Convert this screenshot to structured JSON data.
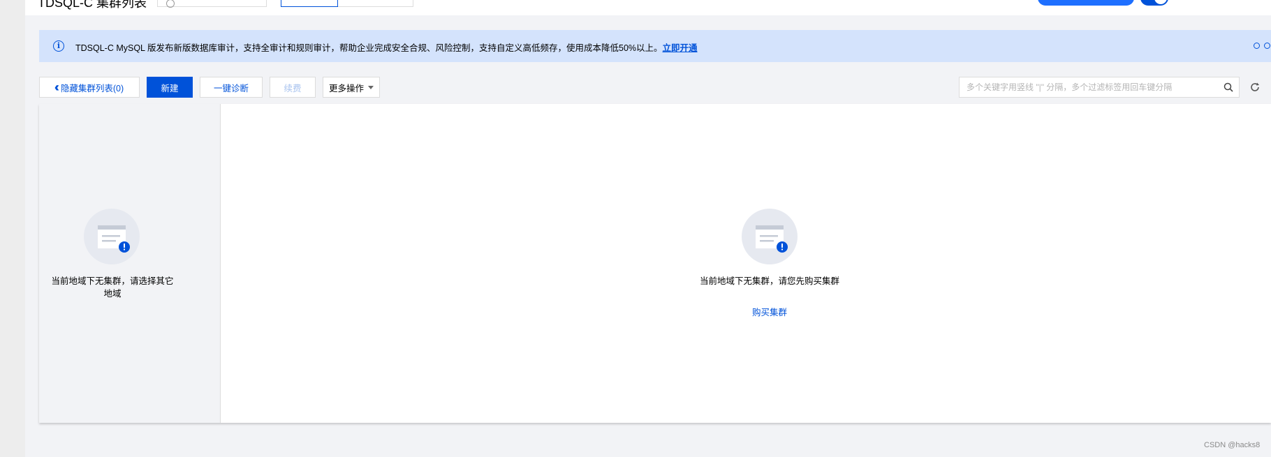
{
  "header": {
    "title": "TDSQL-C 集群列表"
  },
  "banner": {
    "text": "TDSQL-C MySQL 版发布新版数据库审计，支持全审计和规则审计，帮助企业完成安全合规、风险控制，支持自定义高低频存，使用成本降低50%以上。",
    "link_label": "立即开通",
    "icon": "info-icon",
    "dots": 3,
    "active_dot": 3
  },
  "toolbar": {
    "hide_list_label": "隐藏集群列表(0)",
    "new_label": "新建",
    "diagnose_label": "一键诊断",
    "renew_label": "续费",
    "more_label": "更多操作"
  },
  "search": {
    "placeholder": "多个关键字用竖线 \"|\" 分隔，多个过滤标签用回车键分隔",
    "value": ""
  },
  "left_pane": {
    "empty_text": "当前地域下无集群，请选择其它地域"
  },
  "main": {
    "empty_text": "当前地域下无集群，请您先购买集群",
    "buy_link": "购买集群"
  },
  "watermark": "CSDN @hacks8",
  "colors": {
    "primary": "#0052d9",
    "banner_bg": "#d4e3fc",
    "page_bg": "#f2f3f6"
  }
}
